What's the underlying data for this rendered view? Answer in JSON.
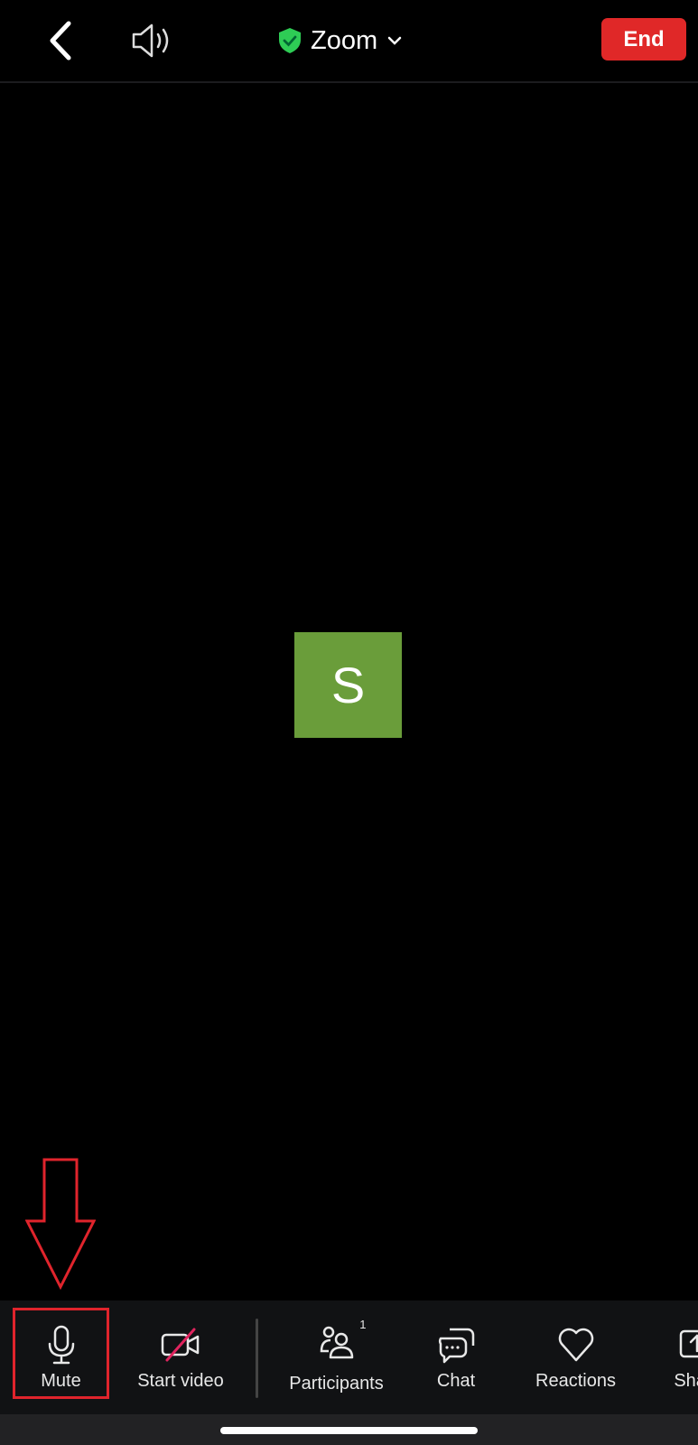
{
  "header": {
    "title": "Zoom",
    "end_label": "End",
    "end_color": "#e02828",
    "secure_color": "#2ecc55"
  },
  "video": {
    "avatar_letter": "S",
    "avatar_color": "#6a9d3a"
  },
  "toolbar": {
    "items": [
      {
        "label": "Mute",
        "icon": "microphone-icon"
      },
      {
        "label": "Start video",
        "icon": "video-off-icon"
      },
      {
        "label": "Participants",
        "icon": "participants-icon",
        "count": "1"
      },
      {
        "label": "Chat",
        "icon": "chat-icon"
      },
      {
        "label": "Reactions",
        "icon": "heart-icon"
      },
      {
        "label": "Share",
        "icon": "share-icon"
      }
    ]
  },
  "annotation": {
    "color": "#e0242c"
  }
}
